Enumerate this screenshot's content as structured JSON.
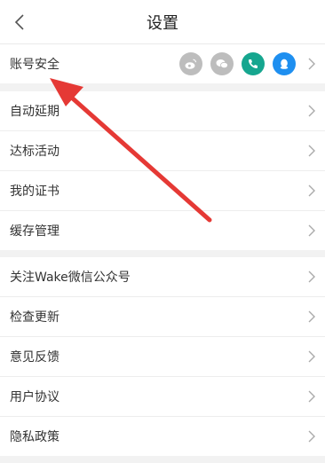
{
  "header": {
    "title": "设置"
  },
  "section1": [
    {
      "label": "账号安全"
    }
  ],
  "section2": [
    {
      "label": "自动延期"
    },
    {
      "label": "达标活动"
    },
    {
      "label": "我的证书"
    },
    {
      "label": "缓存管理"
    }
  ],
  "section3": [
    {
      "label": "关注Wake微信公众号"
    },
    {
      "label": "检查更新"
    },
    {
      "label": "意见反馈"
    },
    {
      "label": "用户协议"
    },
    {
      "label": "隐私政策"
    }
  ],
  "socials": [
    {
      "icon": "weibo-icon",
      "color": "#bdbdbd"
    },
    {
      "icon": "wechat-icon",
      "color": "#bdbdbd"
    },
    {
      "icon": "phone-icon",
      "color": "#16a68f"
    },
    {
      "icon": "qq-icon",
      "color": "#1e8ff0"
    }
  ],
  "colors": {
    "arrow": "#e53935"
  }
}
